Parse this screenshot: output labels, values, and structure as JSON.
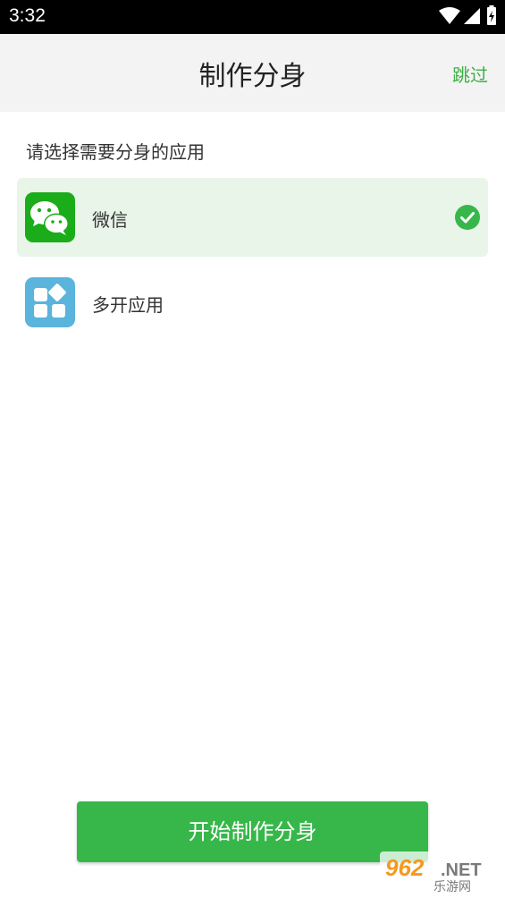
{
  "status_bar": {
    "time": "3:32",
    "icons": [
      "wifi-icon",
      "signal-icon",
      "battery-charging-icon"
    ]
  },
  "header": {
    "title": "制作分身",
    "skip_label": "跳过"
  },
  "prompt": "请选择需要分身的应用",
  "apps": [
    {
      "label": "微信",
      "icon": "wechat-icon",
      "selected": true,
      "icon_color": "#1aad19"
    },
    {
      "label": "多开应用",
      "icon": "multi-app-icon",
      "selected": false,
      "icon_color": "#5ab4dc"
    }
  ],
  "start_button_label": "开始制作分身",
  "watermark": {
    "number": "962",
    "suffix": ".NET",
    "text": "乐游网"
  },
  "colors": {
    "accent": "#37b74a",
    "selected_bg": "#e8f5e8",
    "header_bg": "#f3f3f3",
    "skip_text": "#3cb043"
  }
}
